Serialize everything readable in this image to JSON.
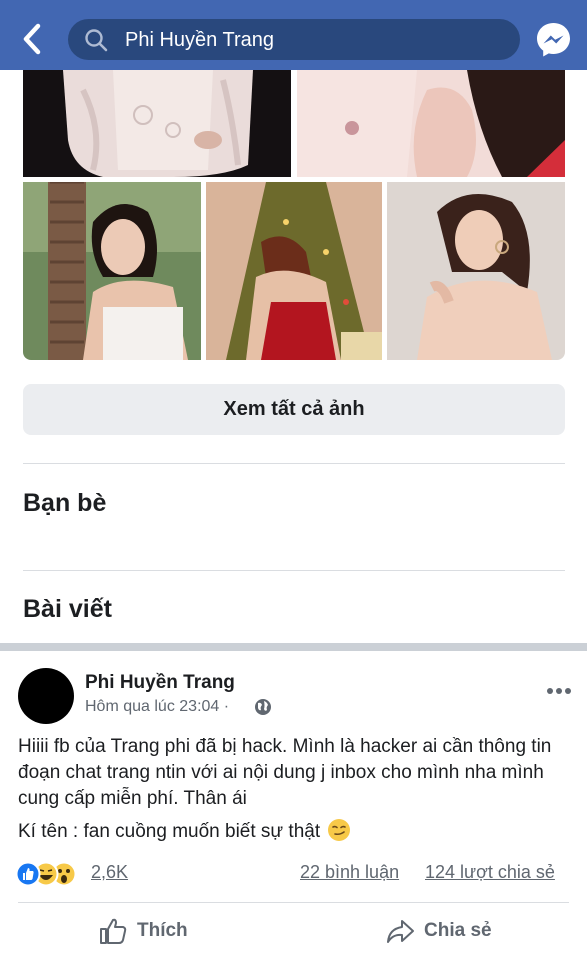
{
  "header": {
    "search_text": "Phi Huyền Trang",
    "back_icon": "back-arrow-icon",
    "search_icon": "search-icon",
    "messenger_icon": "messenger-icon",
    "bg_color": "#4267b2"
  },
  "photos": {
    "see_all_label": "Xem tất cả ảnh"
  },
  "sections": {
    "friends_title": "Bạn bè",
    "posts_title": "Bài viết"
  },
  "post": {
    "author": "Phi Huyền Trang",
    "meta": "Hôm qua lúc 23:04 ·",
    "privacy_icon": "globe-icon",
    "more_icon": "more-options-icon",
    "body_line1": "Hiiii fb của Trang phi đã bị hack. Mình là hacker ai cần thông tin đoạn chat trang ntin với ai nội dung j inbox cho mình nha mình cung cấp miễn phí. Thân ái",
    "body_line2": "Kí tên : fan cuồng muốn biết sự thật",
    "body_emoji": "smirk-emoji-icon",
    "reactions": [
      "like-reaction-icon",
      "haha-reaction-icon",
      "wow-reaction-icon"
    ],
    "reaction_count": "2,6K",
    "comments": "22 bình luận",
    "shares": "124 lượt chia sẻ",
    "like_label": "Thích",
    "share_label": "Chia sẻ"
  }
}
